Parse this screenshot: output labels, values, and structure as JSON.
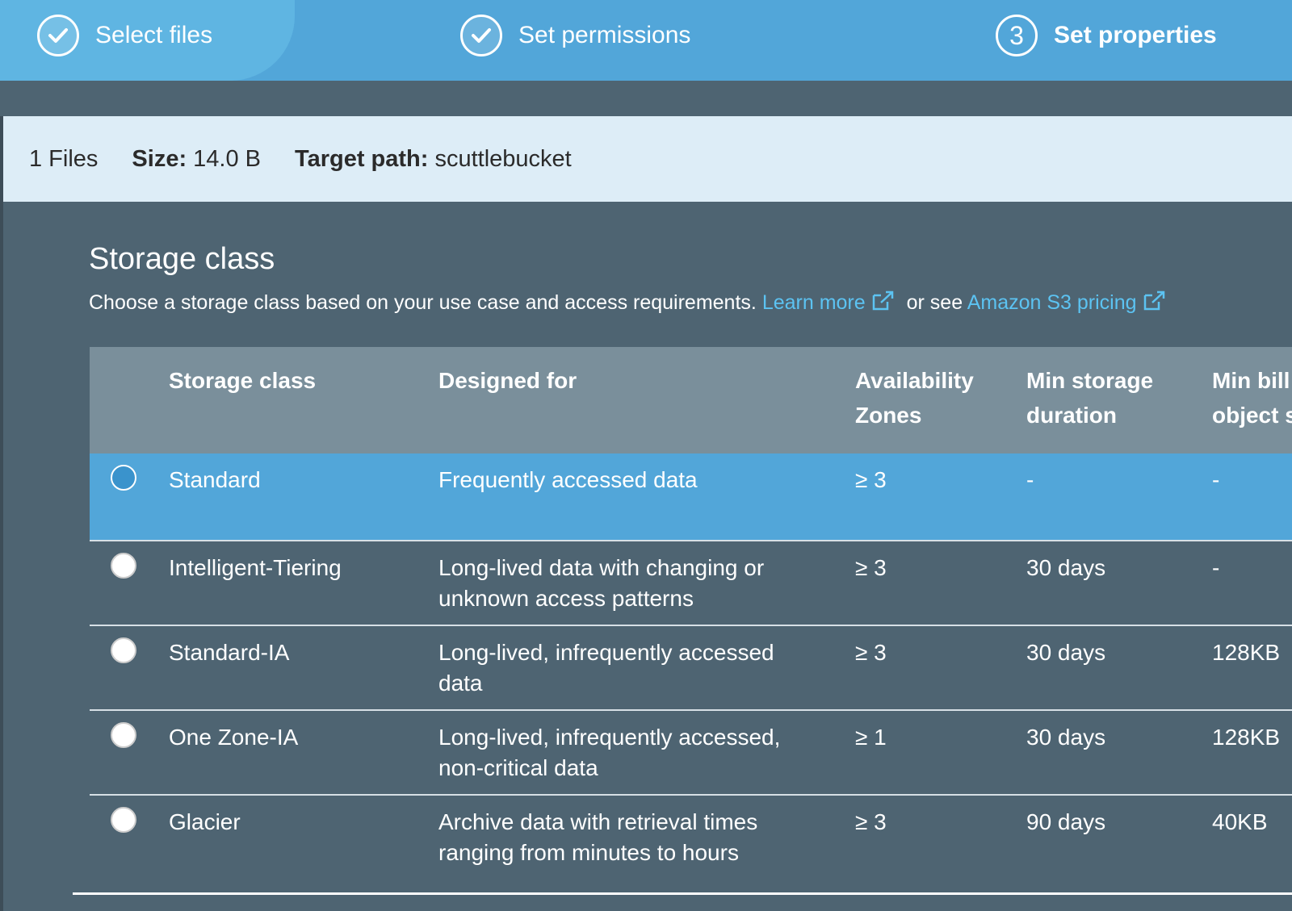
{
  "stepper": {
    "steps": [
      {
        "label": "Select files",
        "state": "done"
      },
      {
        "label": "Set permissions",
        "state": "done"
      },
      {
        "label": "Set properties",
        "state": "current",
        "number": "3"
      }
    ]
  },
  "summary": {
    "files": "1 Files",
    "size_label": "Size:",
    "size_value": "14.0 B",
    "target_label": "Target path:",
    "target_value": "scuttlebucket"
  },
  "storage": {
    "title": "Storage class",
    "desc_prefix": "Choose a storage class based on your use case and access requirements.",
    "learn_more": "Learn more",
    "or_see": "or see",
    "pricing": "Amazon S3 pricing"
  },
  "table": {
    "headers": {
      "storage_class": "Storage class",
      "designed_for": "Designed for",
      "az_1": "Availability",
      "az_2": "Zones",
      "min_storage_1": "Min storage",
      "min_storage_2": "duration",
      "min_bill_1": "Min bill",
      "min_bill_2": "object s"
    },
    "rows": [
      {
        "name": "Standard",
        "designed_1": "Frequently accessed data",
        "designed_2": "",
        "az": "≥ 3",
        "min_storage": "-",
        "min_bill": "-",
        "selected": true
      },
      {
        "name": "Intelligent-Tiering",
        "designed_1": "Long-lived data with changing or",
        "designed_2": "unknown access patterns",
        "az": "≥ 3",
        "min_storage": "30 days",
        "min_bill": "-",
        "selected": false
      },
      {
        "name": "Standard-IA",
        "designed_1": "Long-lived, infrequently accessed",
        "designed_2": "data",
        "az": "≥ 3",
        "min_storage": "30 days",
        "min_bill": "128KB",
        "selected": false
      },
      {
        "name": "One Zone-IA",
        "designed_1": "Long-lived, infrequently accessed,",
        "designed_2": "non-critical data",
        "az": "≥ 1",
        "min_storage": "30 days",
        "min_bill": "128KB",
        "selected": false
      },
      {
        "name": "Glacier",
        "designed_1": "Archive data with retrieval times",
        "designed_2": "ranging from minutes to hours",
        "az": "≥ 3",
        "min_storage": "90 days",
        "min_bill": "40KB",
        "selected": false
      }
    ]
  },
  "colors": {
    "stepper_bg": "#52a6d9",
    "page_bg": "#4e6472",
    "summary_bg": "#ddedf7",
    "link": "#5cc3f2",
    "selected_row": "#52a6d9"
  }
}
